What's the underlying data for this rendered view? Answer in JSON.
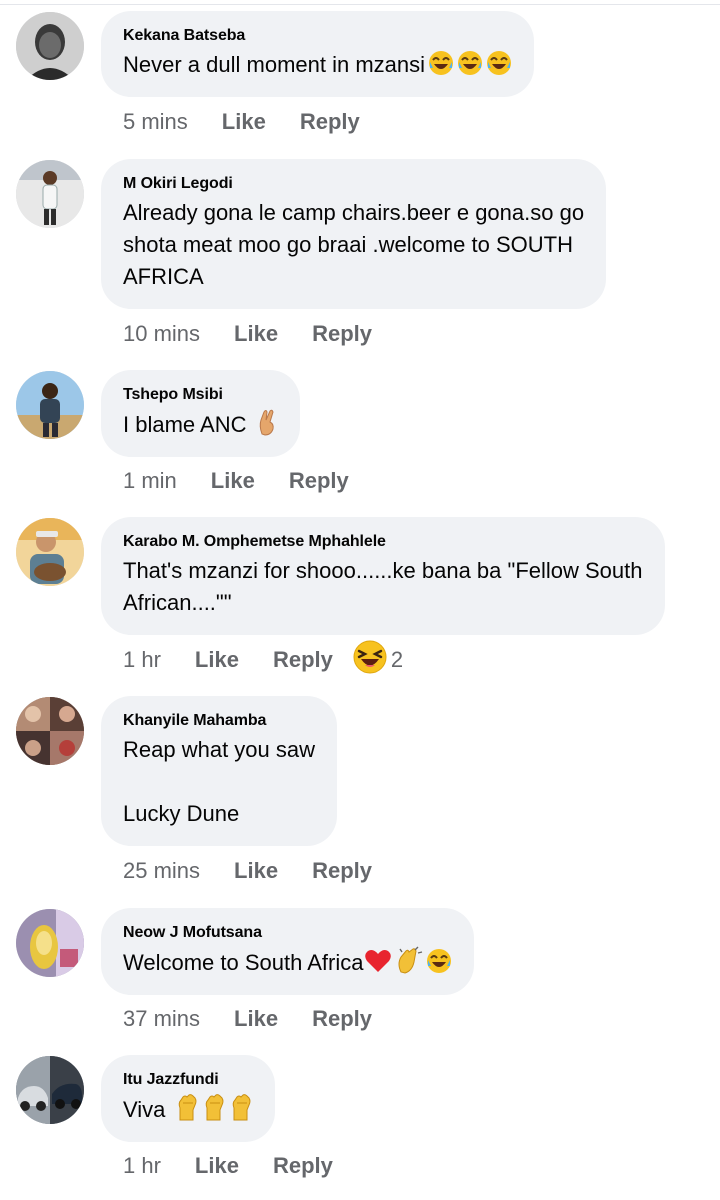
{
  "comments": [
    {
      "author": "Kekana Batseba",
      "text": "Never a dull moment in mzansi",
      "emojis": [
        "tears-of-joy",
        "tears-of-joy",
        "tears-of-joy"
      ],
      "time": "5 mins",
      "like_label": "Like",
      "reply_label": "Reply",
      "reaction": null
    },
    {
      "author": "M Okiri Legodi",
      "text": "Already gona le camp chairs.beer e gona.so go\nshota meat moo go braai .welcome to SOUTH\nAFRICA",
      "emojis": [],
      "time": "10 mins",
      "like_label": "Like",
      "reply_label": "Reply",
      "reaction": null
    },
    {
      "author": "Tshepo Msibi",
      "text": "I blame ANC",
      "emojis": [
        "crossed-fingers"
      ],
      "time": "1 min",
      "like_label": "Like",
      "reply_label": "Reply",
      "reaction": null
    },
    {
      "author": "Karabo M. Omphemetse Mphahlele",
      "text": "That's mzanzi for shooo......ke bana ba \"Fellow South\nAfrican....\"\"",
      "emojis": [],
      "time": "1 hr",
      "like_label": "Like",
      "reply_label": "Reply",
      "reaction": {
        "type": "haha",
        "count": "2"
      }
    },
    {
      "author": "Khanyile Mahamba",
      "text": "Reap what you saw\n\nLucky Dune",
      "emojis": [],
      "time": "25 mins",
      "like_label": "Like",
      "reply_label": "Reply",
      "reaction": null
    },
    {
      "author": "Neow J Mofutsana",
      "text": "Welcome to South Africa",
      "emojis": [
        "red-heart",
        "clapping-hands",
        "tears-of-joy"
      ],
      "time": "37 mins",
      "like_label": "Like",
      "reply_label": "Reply",
      "reaction": null
    },
    {
      "author": "Itu Jazzfundi",
      "text": "Viva",
      "emojis": [
        "raised-fist",
        "raised-fist",
        "raised-fist"
      ],
      "time": "1 hr",
      "like_label": "Like",
      "reply_label": "Reply",
      "reaction": null
    }
  ],
  "colors": {
    "bubble": "#f0f2f5",
    "text": "#050505",
    "meta": "#65676b"
  }
}
